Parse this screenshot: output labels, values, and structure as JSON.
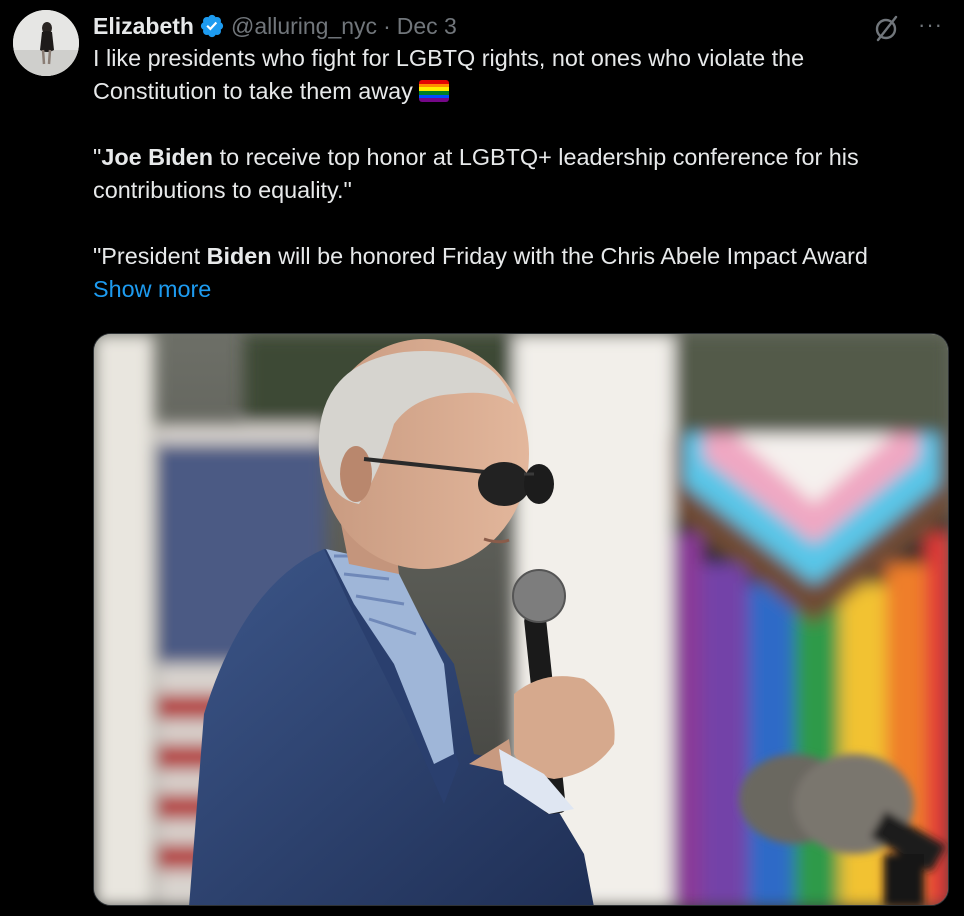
{
  "tweet": {
    "author_name": "Elizabeth",
    "handle": "@alluring_nyc",
    "separator": "·",
    "date": "Dec 3",
    "more_glyph": "···",
    "text": {
      "line1": "I like presidents who fight for LGBTQ rights, not ones who violate the",
      "line2": "Constitution to take them away",
      "quote1_bold": "Joe Biden",
      "quote1_rest1": " to receive top honor at LGBTQ+ leadership conference for his",
      "quote1_line2": "contributions to equality.\"",
      "quote2_pre": "\"President ",
      "quote2_bold": "Biden",
      "quote2_rest": " will be honored Friday with the Chris Abele Impact Award"
    },
    "show_more": "Show more"
  },
  "icons": {
    "verified": "verified-badge-icon",
    "grok": "grok-icon",
    "more": "more-icon",
    "flag": "rainbow-flag-emoji"
  },
  "colors": {
    "background": "#000000",
    "text": "#e7e9ea",
    "muted": "#71767b",
    "link": "#1d9bf0",
    "verified": "#1d9bf0"
  }
}
